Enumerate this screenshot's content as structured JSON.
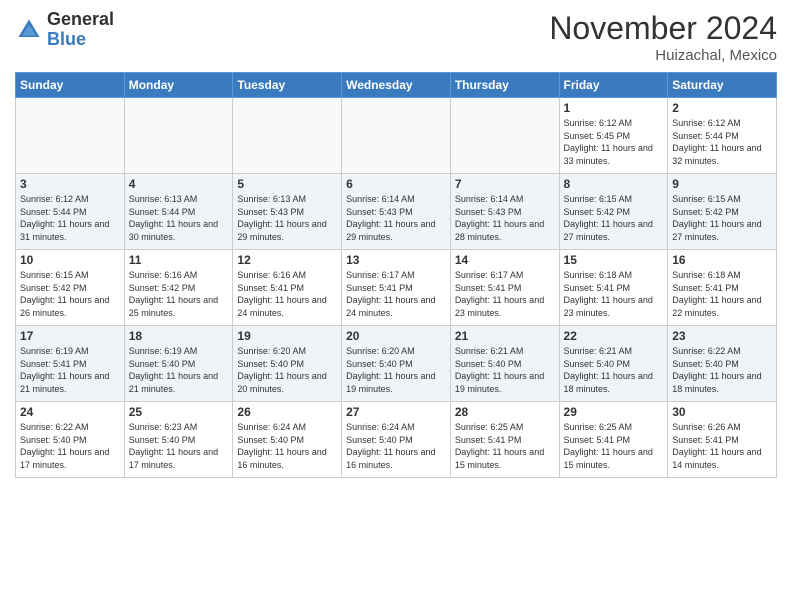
{
  "logo": {
    "general": "General",
    "blue": "Blue"
  },
  "header": {
    "month": "November 2024",
    "location": "Huizachal, Mexico"
  },
  "weekdays": [
    "Sunday",
    "Monday",
    "Tuesday",
    "Wednesday",
    "Thursday",
    "Friday",
    "Saturday"
  ],
  "weeks": [
    [
      {
        "day": "",
        "empty": true
      },
      {
        "day": "",
        "empty": true
      },
      {
        "day": "",
        "empty": true
      },
      {
        "day": "",
        "empty": true
      },
      {
        "day": "",
        "empty": true
      },
      {
        "day": "1",
        "sunrise": "6:12 AM",
        "sunset": "5:45 PM",
        "daylight": "11 hours and 33 minutes."
      },
      {
        "day": "2",
        "sunrise": "6:12 AM",
        "sunset": "5:44 PM",
        "daylight": "11 hours and 32 minutes."
      }
    ],
    [
      {
        "day": "3",
        "sunrise": "6:12 AM",
        "sunset": "5:44 PM",
        "daylight": "11 hours and 31 minutes."
      },
      {
        "day": "4",
        "sunrise": "6:13 AM",
        "sunset": "5:44 PM",
        "daylight": "11 hours and 30 minutes."
      },
      {
        "day": "5",
        "sunrise": "6:13 AM",
        "sunset": "5:43 PM",
        "daylight": "11 hours and 29 minutes."
      },
      {
        "day": "6",
        "sunrise": "6:14 AM",
        "sunset": "5:43 PM",
        "daylight": "11 hours and 29 minutes."
      },
      {
        "day": "7",
        "sunrise": "6:14 AM",
        "sunset": "5:43 PM",
        "daylight": "11 hours and 28 minutes."
      },
      {
        "day": "8",
        "sunrise": "6:15 AM",
        "sunset": "5:42 PM",
        "daylight": "11 hours and 27 minutes."
      },
      {
        "day": "9",
        "sunrise": "6:15 AM",
        "sunset": "5:42 PM",
        "daylight": "11 hours and 27 minutes."
      }
    ],
    [
      {
        "day": "10",
        "sunrise": "6:15 AM",
        "sunset": "5:42 PM",
        "daylight": "11 hours and 26 minutes."
      },
      {
        "day": "11",
        "sunrise": "6:16 AM",
        "sunset": "5:42 PM",
        "daylight": "11 hours and 25 minutes."
      },
      {
        "day": "12",
        "sunrise": "6:16 AM",
        "sunset": "5:41 PM",
        "daylight": "11 hours and 24 minutes."
      },
      {
        "day": "13",
        "sunrise": "6:17 AM",
        "sunset": "5:41 PM",
        "daylight": "11 hours and 24 minutes."
      },
      {
        "day": "14",
        "sunrise": "6:17 AM",
        "sunset": "5:41 PM",
        "daylight": "11 hours and 23 minutes."
      },
      {
        "day": "15",
        "sunrise": "6:18 AM",
        "sunset": "5:41 PM",
        "daylight": "11 hours and 23 minutes."
      },
      {
        "day": "16",
        "sunrise": "6:18 AM",
        "sunset": "5:41 PM",
        "daylight": "11 hours and 22 minutes."
      }
    ],
    [
      {
        "day": "17",
        "sunrise": "6:19 AM",
        "sunset": "5:41 PM",
        "daylight": "11 hours and 21 minutes."
      },
      {
        "day": "18",
        "sunrise": "6:19 AM",
        "sunset": "5:40 PM",
        "daylight": "11 hours and 21 minutes."
      },
      {
        "day": "19",
        "sunrise": "6:20 AM",
        "sunset": "5:40 PM",
        "daylight": "11 hours and 20 minutes."
      },
      {
        "day": "20",
        "sunrise": "6:20 AM",
        "sunset": "5:40 PM",
        "daylight": "11 hours and 19 minutes."
      },
      {
        "day": "21",
        "sunrise": "6:21 AM",
        "sunset": "5:40 PM",
        "daylight": "11 hours and 19 minutes."
      },
      {
        "day": "22",
        "sunrise": "6:21 AM",
        "sunset": "5:40 PM",
        "daylight": "11 hours and 18 minutes."
      },
      {
        "day": "23",
        "sunrise": "6:22 AM",
        "sunset": "5:40 PM",
        "daylight": "11 hours and 18 minutes."
      }
    ],
    [
      {
        "day": "24",
        "sunrise": "6:22 AM",
        "sunset": "5:40 PM",
        "daylight": "11 hours and 17 minutes."
      },
      {
        "day": "25",
        "sunrise": "6:23 AM",
        "sunset": "5:40 PM",
        "daylight": "11 hours and 17 minutes."
      },
      {
        "day": "26",
        "sunrise": "6:24 AM",
        "sunset": "5:40 PM",
        "daylight": "11 hours and 16 minutes."
      },
      {
        "day": "27",
        "sunrise": "6:24 AM",
        "sunset": "5:40 PM",
        "daylight": "11 hours and 16 minutes."
      },
      {
        "day": "28",
        "sunrise": "6:25 AM",
        "sunset": "5:41 PM",
        "daylight": "11 hours and 15 minutes."
      },
      {
        "day": "29",
        "sunrise": "6:25 AM",
        "sunset": "5:41 PM",
        "daylight": "11 hours and 15 minutes."
      },
      {
        "day": "30",
        "sunrise": "6:26 AM",
        "sunset": "5:41 PM",
        "daylight": "11 hours and 14 minutes."
      }
    ]
  ]
}
